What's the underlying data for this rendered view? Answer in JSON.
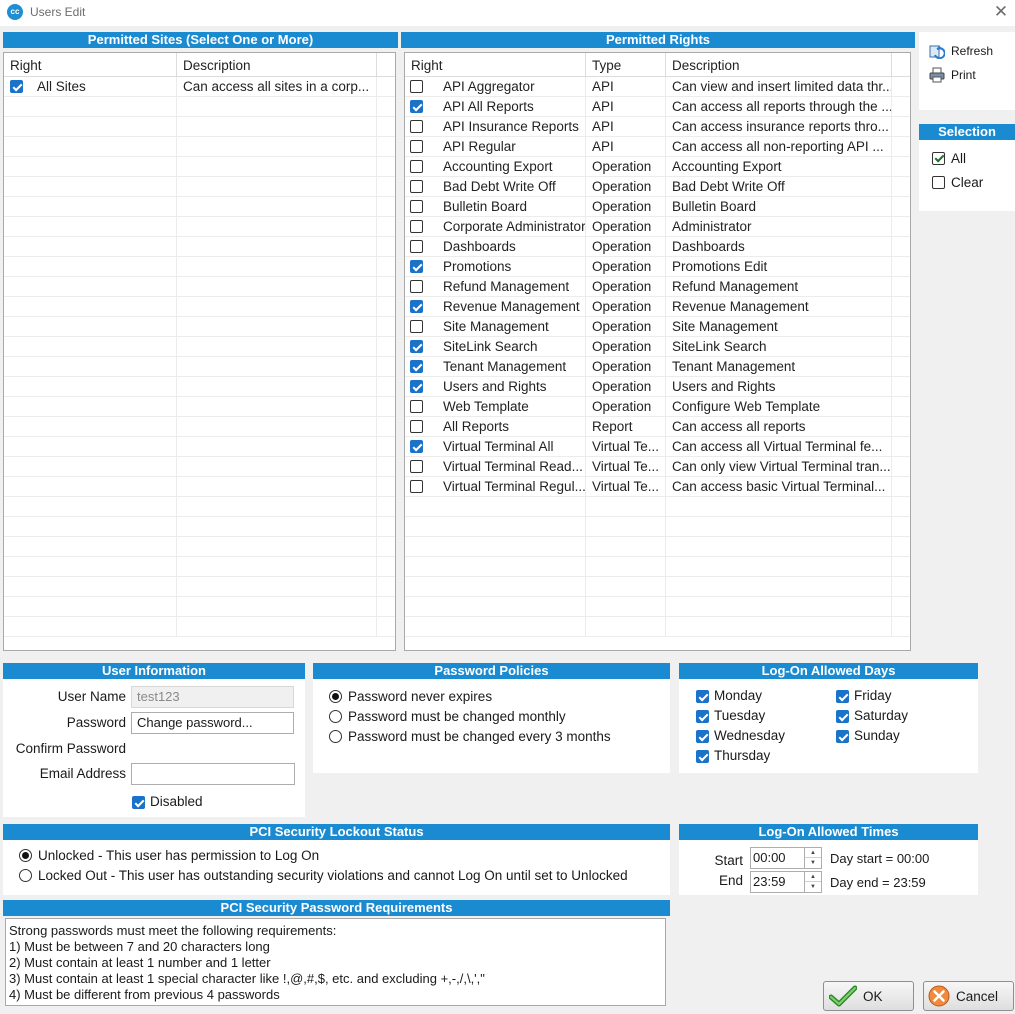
{
  "window": {
    "title": "Users Edit",
    "logo_text": "cc",
    "close_glyph": "✕"
  },
  "sites": {
    "header": "Permitted Sites (Select One or More)",
    "columns": [
      "Right",
      "Description"
    ],
    "rows": [
      {
        "checked": true,
        "right": "All Sites",
        "description": "Can access all sites in a corp..."
      }
    ]
  },
  "rights": {
    "header": "Permitted Rights",
    "columns": [
      "Right",
      "Type",
      "Description"
    ],
    "rows": [
      {
        "checked": false,
        "right": "API Aggregator",
        "type": "API",
        "description": "Can view and insert limited data thr..."
      },
      {
        "checked": true,
        "right": "API All Reports",
        "type": "API",
        "description": "Can access all reports through the ..."
      },
      {
        "checked": false,
        "right": "API Insurance Reports",
        "type": "API",
        "description": "Can access insurance reports thro..."
      },
      {
        "checked": false,
        "right": "API Regular",
        "type": "API",
        "description": "Can access all non-reporting API ..."
      },
      {
        "checked": false,
        "right": "Accounting Export",
        "type": "Operation",
        "description": "Accounting Export"
      },
      {
        "checked": false,
        "right": "Bad Debt Write Off",
        "type": "Operation",
        "description": "Bad Debt Write Off"
      },
      {
        "checked": false,
        "right": "Bulletin Board",
        "type": "Operation",
        "description": "Bulletin Board"
      },
      {
        "checked": false,
        "right": "Corporate Administrator",
        "type": "Operation",
        "description": "Administrator"
      },
      {
        "checked": false,
        "right": "Dashboards",
        "type": "Operation",
        "description": "Dashboards"
      },
      {
        "checked": true,
        "right": "Promotions",
        "type": "Operation",
        "description": "Promotions Edit"
      },
      {
        "checked": false,
        "right": "Refund Management",
        "type": "Operation",
        "description": "Refund Management"
      },
      {
        "checked": true,
        "right": "Revenue Management",
        "type": "Operation",
        "description": "Revenue Management"
      },
      {
        "checked": false,
        "right": "Site Management",
        "type": "Operation",
        "description": "Site Management"
      },
      {
        "checked": true,
        "right": "SiteLink Search",
        "type": "Operation",
        "description": "SiteLink Search"
      },
      {
        "checked": true,
        "right": "Tenant Management",
        "type": "Operation",
        "description": "Tenant Management"
      },
      {
        "checked": true,
        "right": "Users and Rights",
        "type": "Operation",
        "description": "Users and Rights"
      },
      {
        "checked": false,
        "right": "Web Template",
        "type": "Operation",
        "description": "Configure Web Template"
      },
      {
        "checked": false,
        "right": "All Reports",
        "type": "Report",
        "description": "Can access all reports"
      },
      {
        "checked": true,
        "right": "Virtual Terminal All",
        "type": "Virtual Te...",
        "description": "Can access all Virtual Terminal fe..."
      },
      {
        "checked": false,
        "right": "Virtual Terminal Read...",
        "type": "Virtual Te...",
        "description": "Can only view Virtual Terminal tran..."
      },
      {
        "checked": false,
        "right": "Virtual Terminal Regul...",
        "type": "Virtual Te...",
        "description": "Can access basic Virtual Terminal..."
      }
    ]
  },
  "toolbar": {
    "refresh": "Refresh",
    "print": "Print",
    "refresh_icon": "refresh-icon",
    "print_icon": "printer-icon"
  },
  "selection": {
    "header": "Selection",
    "all": "All",
    "clear": "Clear",
    "all_checked": true,
    "clear_checked": false
  },
  "user_info": {
    "header": "User Information",
    "username_label": "User Name",
    "username_value": "test123",
    "password_label": "Password",
    "password_value": "Change password...",
    "confirm_label": "Confirm Password",
    "email_label": "Email Address",
    "email_value": "",
    "disabled_label": "Disabled",
    "disabled_checked": true
  },
  "password_policies": {
    "header": "Password Policies",
    "options": [
      {
        "label": "Password never expires",
        "selected": true
      },
      {
        "label": "Password must be changed monthly",
        "selected": false
      },
      {
        "label": "Password must be changed every 3 months",
        "selected": false
      }
    ]
  },
  "logon_days": {
    "header": "Log-On Allowed Days",
    "days": [
      {
        "label": "Monday",
        "checked": true
      },
      {
        "label": "Tuesday",
        "checked": true
      },
      {
        "label": "Wednesday",
        "checked": true
      },
      {
        "label": "Thursday",
        "checked": true
      },
      {
        "label": "Friday",
        "checked": true
      },
      {
        "label": "Saturday",
        "checked": true
      },
      {
        "label": "Sunday",
        "checked": true
      }
    ]
  },
  "lockout": {
    "header": "PCI Security Lockout Status",
    "options": [
      {
        "label": "Unlocked - This user has permission to Log On",
        "selected": true
      },
      {
        "label": "Locked Out - This user has outstanding security violations and cannot Log On until set to Unlocked",
        "selected": false
      }
    ]
  },
  "logon_times": {
    "header": "Log-On Allowed Times",
    "start_label": "Start",
    "start_value": "00:00",
    "start_note": "Day start = 00:00",
    "end_label": "End",
    "end_value": "23:59",
    "end_note": "Day end = 23:59"
  },
  "requirements": {
    "header": "PCI Security Password Requirements",
    "lines": [
      "Strong passwords must meet the following requirements:",
      "1) Must be between 7 and 20 characters long",
      "2) Must contain at least 1 number and 1 letter",
      "3) Must contain at least 1 special character like !,@,#,$, etc. and excluding +,-,/,\\,',\"",
      "4) Must be different from previous 4 passwords"
    ]
  },
  "buttons": {
    "ok": "OK",
    "cancel": "Cancel",
    "ok_icon": "checkmark-icon",
    "cancel_icon": "cancel-icon"
  },
  "colors": {
    "header_blue": "#1b8bd1",
    "check_blue": "#1a73c9",
    "ok_green": "#3fa33a",
    "cancel_orange": "#e8702a"
  }
}
